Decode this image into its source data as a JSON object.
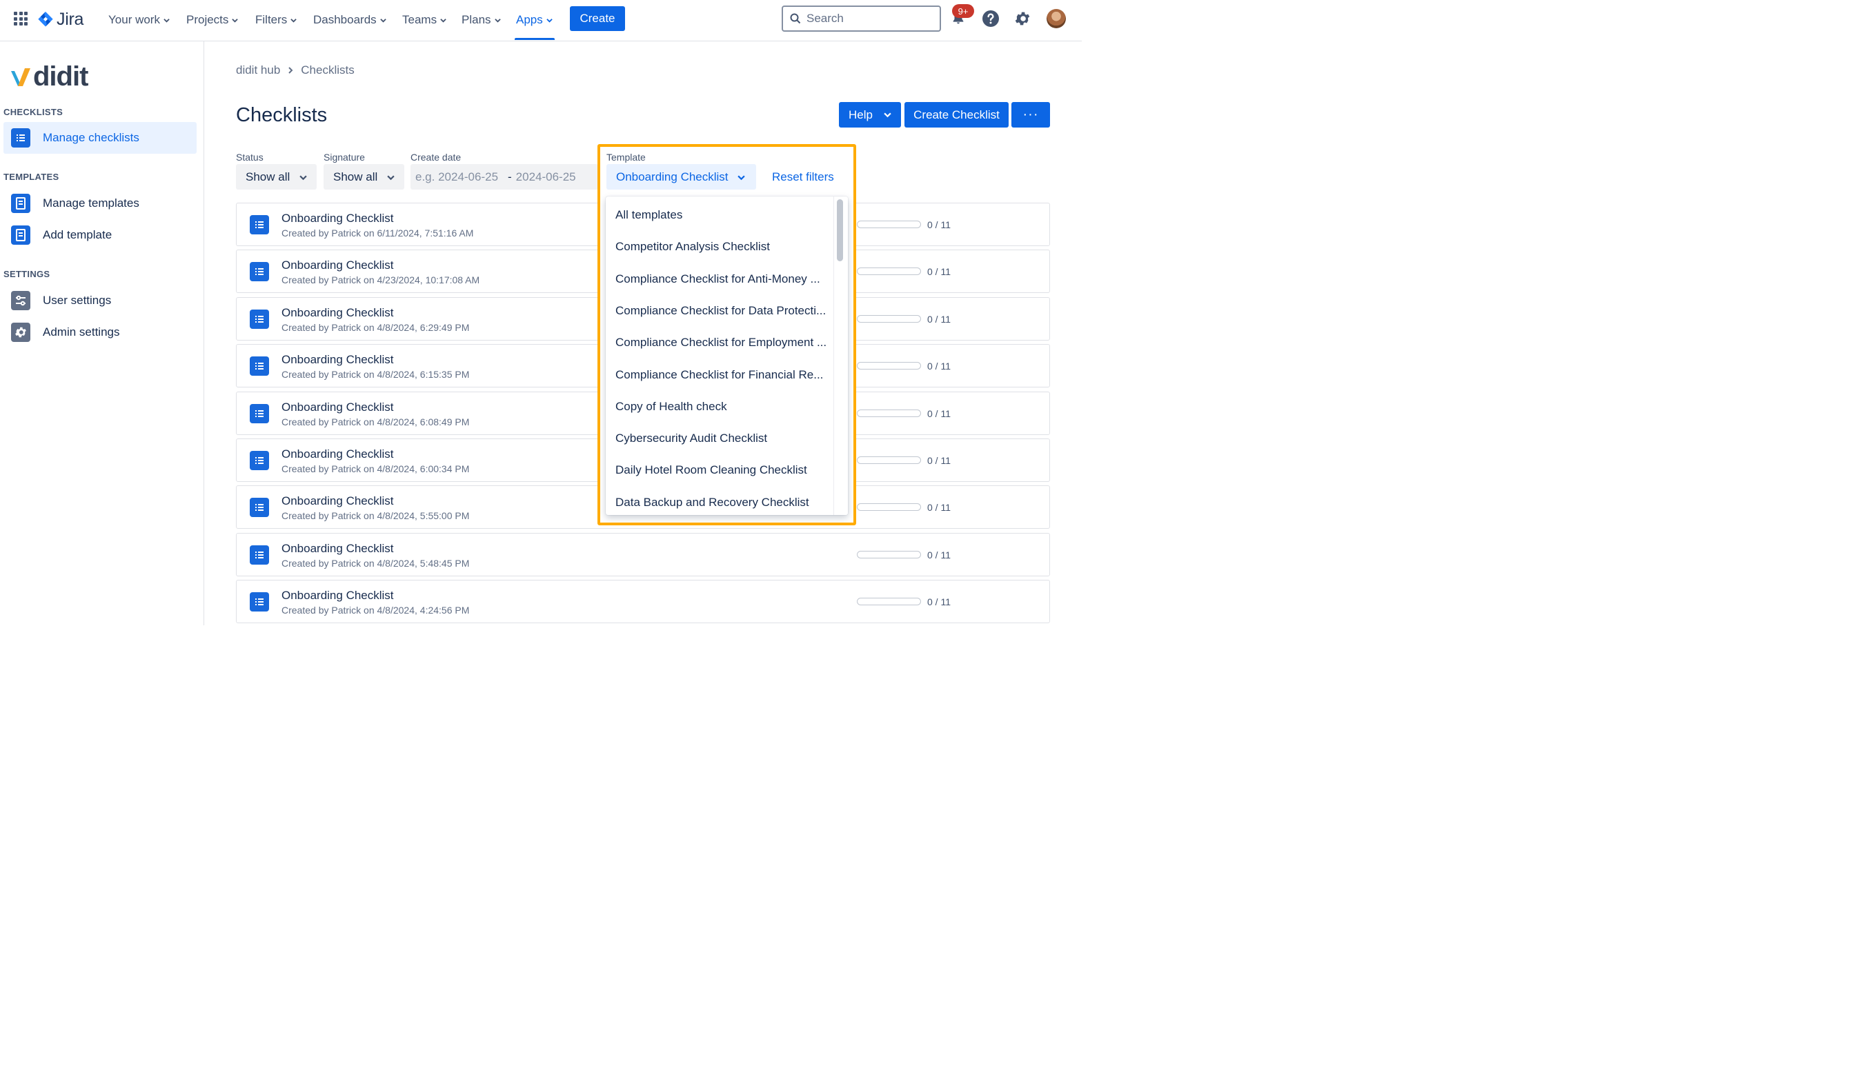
{
  "topnav": {
    "app_name": "Jira",
    "items": [
      {
        "label": "Your work"
      },
      {
        "label": "Projects"
      },
      {
        "label": "Filters"
      },
      {
        "label": "Dashboards"
      },
      {
        "label": "Teams"
      },
      {
        "label": "Plans"
      },
      {
        "label": "Apps",
        "active": true
      }
    ],
    "create_label": "Create",
    "search_placeholder": "Search",
    "notifications_badge": "9+",
    "accent_color": "#0c66e4"
  },
  "sidebar": {
    "brand": "didit",
    "sections": [
      {
        "heading": "CHECKLISTS",
        "items": [
          {
            "label": "Manage checklists",
            "icon": "checklist-icon",
            "selected": true
          }
        ]
      },
      {
        "heading": "TEMPLATES",
        "items": [
          {
            "label": "Manage templates",
            "icon": "template-icon"
          },
          {
            "label": "Add template",
            "icon": "template-icon"
          }
        ]
      },
      {
        "heading": "SETTINGS",
        "items": [
          {
            "label": "User settings",
            "icon": "sliders-icon"
          },
          {
            "label": "Admin settings",
            "icon": "gear-icon"
          }
        ]
      }
    ]
  },
  "breadcrumb": [
    "didit hub",
    "Checklists"
  ],
  "page": {
    "title": "Checklists",
    "help_label": "Help",
    "create_checklist_label": "Create Checklist",
    "more_label": "···"
  },
  "filters": {
    "status": {
      "label": "Status",
      "value": "Show all"
    },
    "signature": {
      "label": "Signature",
      "value": "Show all"
    },
    "create_date": {
      "label": "Create date",
      "from_placeholder": "e.g. 2024-06-25",
      "separator": "-",
      "to_placeholder": "2024-06-25"
    },
    "template": {
      "label": "Template",
      "value": "Onboarding Checklist"
    },
    "reset_label": "Reset filters"
  },
  "template_dropdown": {
    "options": [
      "All templates",
      "Competitor Analysis Checklist",
      "Compliance Checklist for Anti-Money ...",
      "Compliance Checklist for Data Protecti...",
      "Compliance Checklist for Employment ...",
      "Compliance Checklist for Financial Re...",
      "Copy of Health check",
      "Cybersecurity Audit Checklist",
      "Daily Hotel Room Cleaning Checklist",
      "Data Backup and Recovery Checklist"
    ],
    "highlight_color": "#ffab00"
  },
  "checklists": [
    {
      "title": "Onboarding Checklist",
      "subtitle": "Created by Patrick on 6/11/2024, 7:51:16 AM",
      "progress": "0 / 11",
      "progress_fraction": 0
    },
    {
      "title": "Onboarding Checklist",
      "subtitle": "Created by Patrick on 4/23/2024, 10:17:08 AM",
      "progress": "0 / 11",
      "progress_fraction": 0
    },
    {
      "title": "Onboarding Checklist",
      "subtitle": "Created by Patrick on 4/8/2024, 6:29:49 PM",
      "progress": "0 / 11",
      "progress_fraction": 0
    },
    {
      "title": "Onboarding Checklist",
      "subtitle": "Created by Patrick on 4/8/2024, 6:15:35 PM",
      "progress": "0 / 11",
      "progress_fraction": 0
    },
    {
      "title": "Onboarding Checklist",
      "subtitle": "Created by Patrick on 4/8/2024, 6:08:49 PM",
      "progress": "0 / 11",
      "progress_fraction": 0
    },
    {
      "title": "Onboarding Checklist",
      "subtitle": "Created by Patrick on 4/8/2024, 6:00:34 PM",
      "progress": "0 / 11",
      "progress_fraction": 0
    },
    {
      "title": "Onboarding Checklist",
      "subtitle": "Created by Patrick on 4/8/2024, 5:55:00 PM",
      "progress": "0 / 11",
      "progress_fraction": 0
    },
    {
      "title": "Onboarding Checklist",
      "subtitle": "Created by Patrick on 4/8/2024, 5:48:45 PM",
      "progress": "0 / 11",
      "progress_fraction": 0
    },
    {
      "title": "Onboarding Checklist",
      "subtitle": "Created by Patrick on 4/8/2024, 4:24:56 PM",
      "progress": "0 / 11",
      "progress_fraction": 0
    }
  ]
}
